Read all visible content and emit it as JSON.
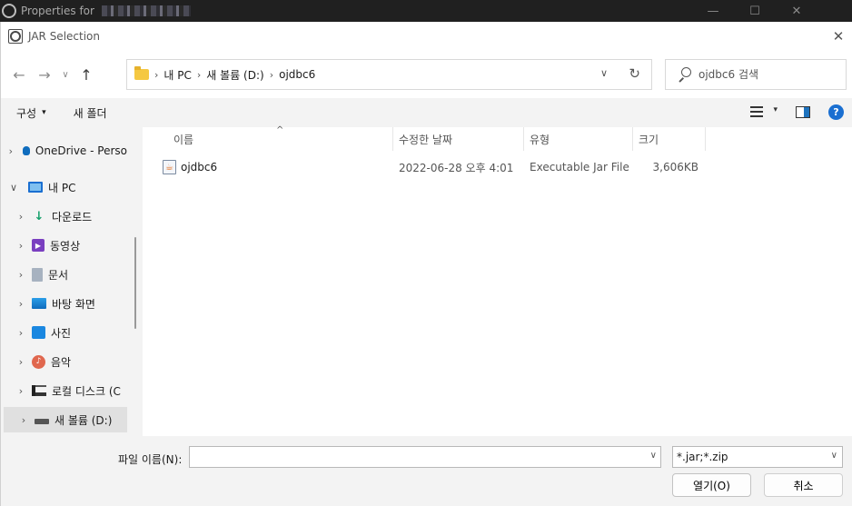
{
  "background_window": {
    "title": "Properties for",
    "controls": [
      "—",
      "☐",
      "✕"
    ]
  },
  "dialog": {
    "title": "JAR Selection",
    "close": "✕"
  },
  "nav_buttons": {
    "back": "←",
    "forward": "→",
    "recent": "∨",
    "up": "↑"
  },
  "address": {
    "breadcrumb": [
      "내 PC",
      "새 볼륨 (D:)",
      "ojdbc6"
    ],
    "separator": "›",
    "dropdown": "∨",
    "refresh": "↻"
  },
  "search": {
    "placeholder": "ojdbc6 검색"
  },
  "command_bar": {
    "organize": "구성",
    "organize_caret": "▾",
    "new_folder": "새 폴더",
    "view_caret": "▾",
    "help": "?"
  },
  "nav_pane": {
    "items": [
      {
        "label": "OneDrive - Perso",
        "icon": "onedrive-icon",
        "chevron": "›"
      },
      {
        "label": "내 PC",
        "icon": "pc-icon",
        "chevron": "∨"
      },
      {
        "label": "다운로드",
        "icon": "download-icon",
        "chevron": "›",
        "glyph": "↓"
      },
      {
        "label": "동영상",
        "icon": "video-icon",
        "chevron": "›",
        "glyph": "▶"
      },
      {
        "label": "문서",
        "icon": "documents-icon",
        "chevron": "›"
      },
      {
        "label": "바탕 화면",
        "icon": "desktop-icon",
        "chevron": "›"
      },
      {
        "label": "사진",
        "icon": "pictures-icon",
        "chevron": "›"
      },
      {
        "label": "음악",
        "icon": "music-icon",
        "chevron": "›",
        "glyph": "♪"
      },
      {
        "label": "로컬 디스크 (C",
        "icon": "local-disk-icon",
        "chevron": "›"
      },
      {
        "label": "새 볼륨 (D:)",
        "icon": "drive-icon",
        "chevron": "›",
        "selected": true
      }
    ]
  },
  "file_list": {
    "sort_arrow": "^",
    "columns": [
      "이름",
      "수정한 날짜",
      "유형",
      "크기"
    ],
    "rows": [
      {
        "name": "ojdbc6",
        "modified": "2022-06-28 오후 4:01",
        "type": "Executable Jar File",
        "size": "3,606KB",
        "icon_glyph": "☕"
      }
    ]
  },
  "bottom": {
    "filename_label": "파일 이름(N):",
    "filename_value": "",
    "filename_dropdown": "∨",
    "filter": "*.jar;*.zip",
    "filter_dropdown": "∨",
    "open_button": "열기(O)",
    "cancel_button": "취소"
  }
}
